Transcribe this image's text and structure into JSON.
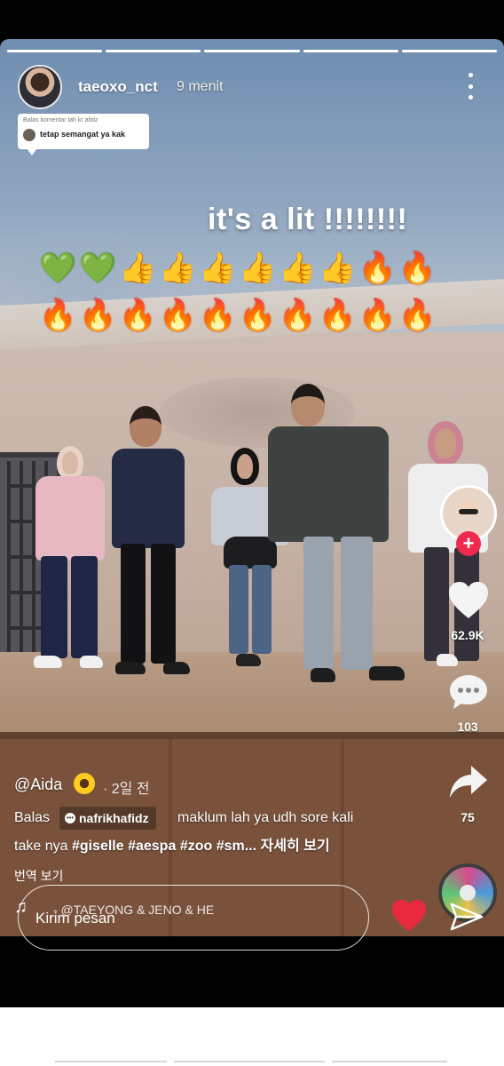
{
  "story": {
    "segments": [
      {
        "active": true
      },
      {
        "active": true
      },
      {
        "active": false
      },
      {
        "active": false
      },
      {
        "active": false
      }
    ]
  },
  "header": {
    "username": "taeoxo_nct",
    "timestamp": "9 menit",
    "more_icon": "more-vertical-icon"
  },
  "reply_bubble": {
    "heading": "Balas komentar lah kr afidz",
    "text": "tetap semangat ya kak"
  },
  "overlay": {
    "headline": "it's a lit !!!!!!!!",
    "emoji_row1": [
      "💚",
      "💚",
      "👍",
      "👍",
      "👍",
      "👍",
      "👍",
      "👍",
      "🔥",
      "🔥"
    ],
    "emoji_row2": [
      "🔥",
      "🔥",
      "🔥",
      "🔥",
      "🔥",
      "🔥",
      "🔥",
      "🔥",
      "🔥",
      "🔥"
    ]
  },
  "actions": {
    "likes": "62.9K",
    "comments": "103",
    "shares": "75",
    "follow_label": "+"
  },
  "post": {
    "author": "@Aida",
    "age": "· 2일 전",
    "caption_prefix": "Balas",
    "mention": "nafrikhafidz",
    "caption_rest": "maklum lah ya udh sore kali",
    "caption_line2_plain": "take nya ",
    "hashtags": "#giselle #aespa #zoo #sm...",
    "see_more": "자세히 보기",
    "translate": "번역 보기",
    "music": "- @TAEYONG & JENO & HE"
  },
  "message": {
    "placeholder": "Kirim pesan"
  },
  "colors": {
    "accent_red": "#f0294f",
    "heart_red": "#e8293e"
  }
}
